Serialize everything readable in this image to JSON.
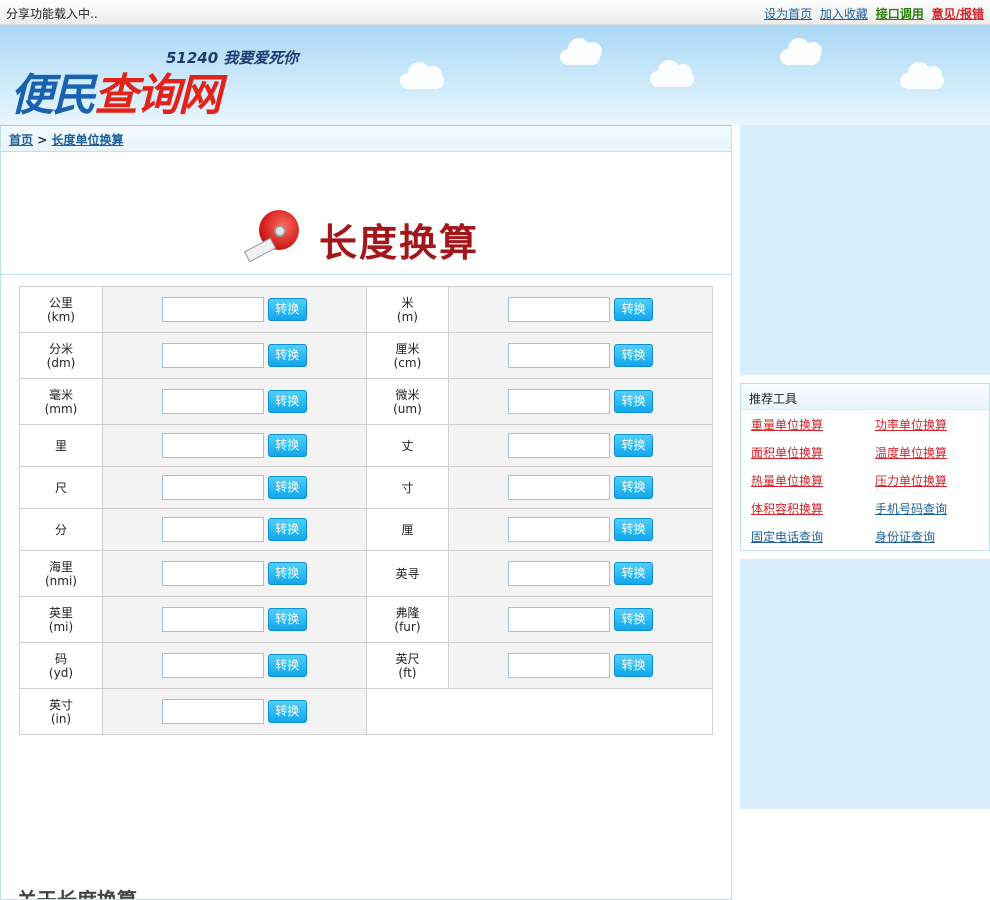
{
  "topbar": {
    "share_text": "分享功能载入中..",
    "links": [
      {
        "label": "设为首页",
        "style": "blue"
      },
      {
        "label": "加入收藏",
        "style": "blue"
      },
      {
        "label": "接口调用",
        "style": "green"
      },
      {
        "label": "意见/报错",
        "style": "red"
      }
    ]
  },
  "logo": {
    "tagline": "51240 我要爱死你",
    "part1": "便民",
    "part2": "查询网"
  },
  "breadcrumb": {
    "home": "首页",
    "separator": ">",
    "current": "长度单位换算"
  },
  "banner": {
    "title": "长度换算"
  },
  "convert_button_label": "转换",
  "units": [
    {
      "name": "公里",
      "abbr": "(km)"
    },
    {
      "name": "米",
      "abbr": "(m)"
    },
    {
      "name": "分米",
      "abbr": "(dm)"
    },
    {
      "name": "厘米",
      "abbr": "(cm)"
    },
    {
      "name": "毫米",
      "abbr": "(mm)"
    },
    {
      "name": "微米",
      "abbr": "(um)"
    },
    {
      "name": "里",
      "abbr": ""
    },
    {
      "name": "丈",
      "abbr": ""
    },
    {
      "name": "尺",
      "abbr": ""
    },
    {
      "name": "寸",
      "abbr": ""
    },
    {
      "name": "分",
      "abbr": ""
    },
    {
      "name": "厘",
      "abbr": ""
    },
    {
      "name": "海里",
      "abbr": "(nmi)"
    },
    {
      "name": "英寻",
      "abbr": ""
    },
    {
      "name": "英里",
      "abbr": "(mi)"
    },
    {
      "name": "弗隆",
      "abbr": "(fur)"
    },
    {
      "name": "码",
      "abbr": "(yd)"
    },
    {
      "name": "英尺",
      "abbr": "(ft)"
    },
    {
      "name": "英寸",
      "abbr": "(in)"
    }
  ],
  "about_title": "关于长度换算",
  "recommend": {
    "title": "推荐工具",
    "items": [
      {
        "label": "重量单位换算",
        "color": "red"
      },
      {
        "label": "功率单位换算",
        "color": "red"
      },
      {
        "label": "面积单位换算",
        "color": "red"
      },
      {
        "label": "温度单位换算",
        "color": "red"
      },
      {
        "label": "热量单位换算",
        "color": "red"
      },
      {
        "label": "压力单位换算",
        "color": "red"
      },
      {
        "label": "体积容积换算",
        "color": "red"
      },
      {
        "label": "手机号码查询",
        "color": "blue"
      },
      {
        "label": "固定电话查询",
        "color": "blue"
      },
      {
        "label": "身份证查询",
        "color": "blue"
      }
    ]
  }
}
